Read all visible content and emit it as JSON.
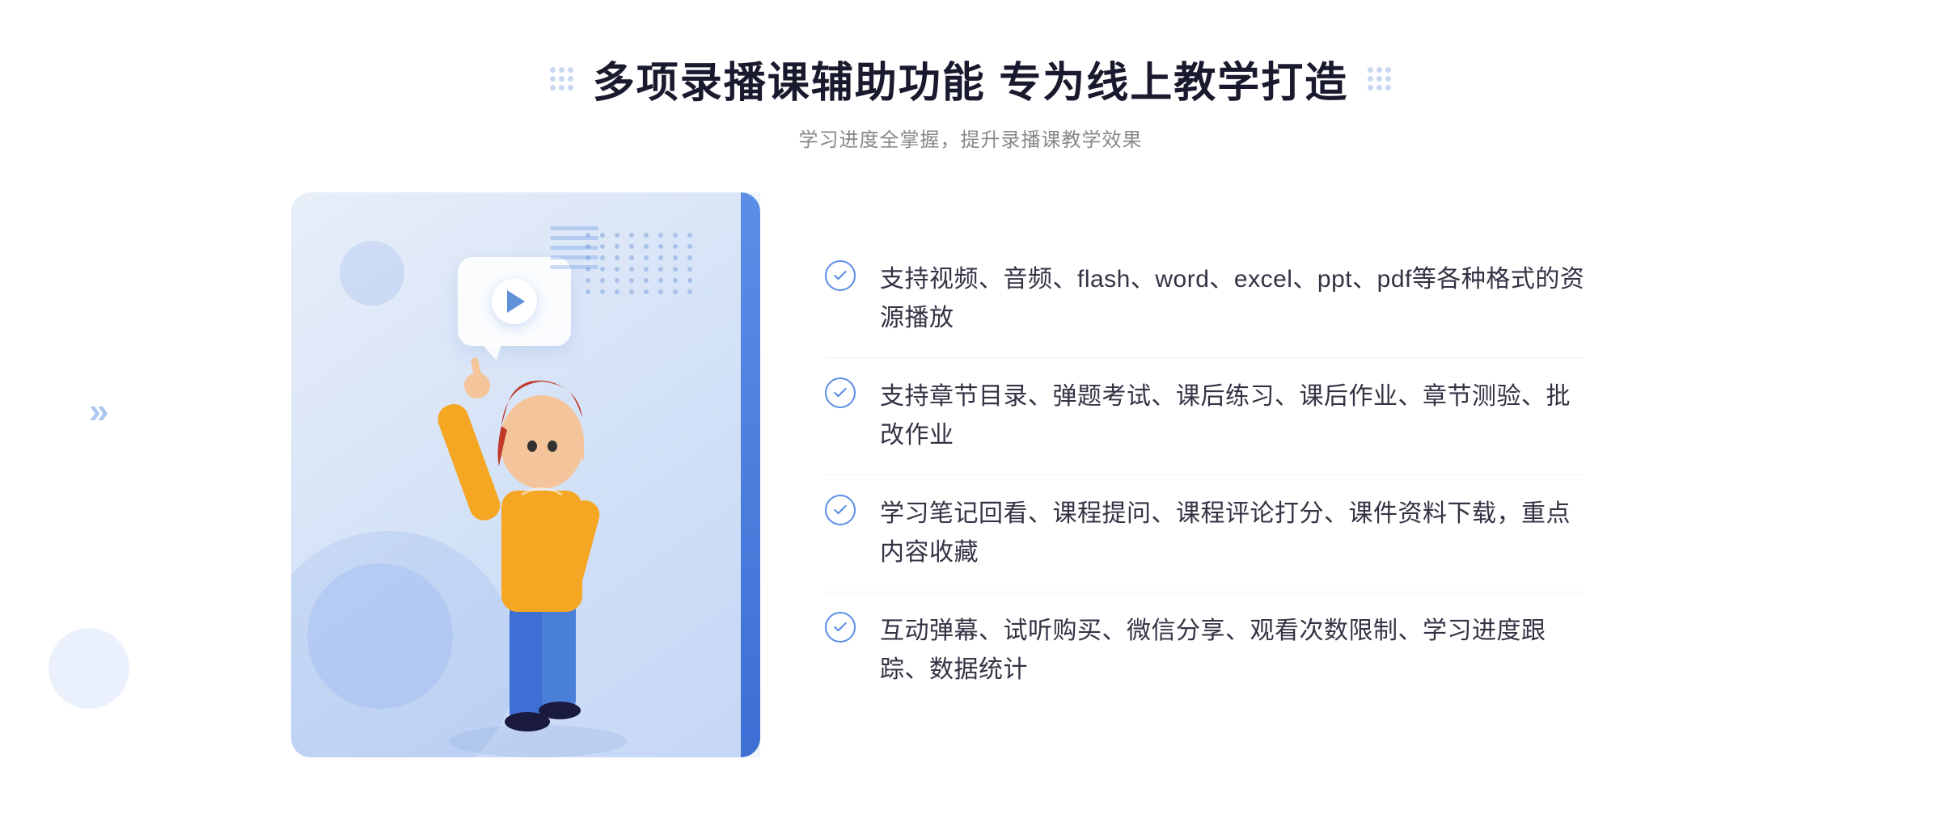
{
  "header": {
    "title": "多项录播课辅助功能 专为线上教学打造",
    "subtitle": "学习进度全掌握，提升录播课教学效果"
  },
  "features": [
    {
      "id": "feature-1",
      "text": "支持视频、音频、flash、word、excel、ppt、pdf等各种格式的资源播放"
    },
    {
      "id": "feature-2",
      "text": "支持章节目录、弹题考试、课后练习、课后作业、章节测验、批改作业"
    },
    {
      "id": "feature-3",
      "text": "学习笔记回看、课程提问、课程评论打分、课件资料下载，重点内容收藏"
    },
    {
      "id": "feature-4",
      "text": "互动弹幕、试听购买、微信分享、观看次数限制、学习进度跟踪、数据统计"
    }
  ],
  "colors": {
    "primary_blue": "#5b8ee6",
    "dark_blue": "#3d6fd4",
    "text_dark": "#333344",
    "text_sub": "#888888",
    "bg_light": "#f0f4fb"
  },
  "icons": {
    "check": "✓",
    "play": "▶",
    "arrow_right": "»"
  }
}
